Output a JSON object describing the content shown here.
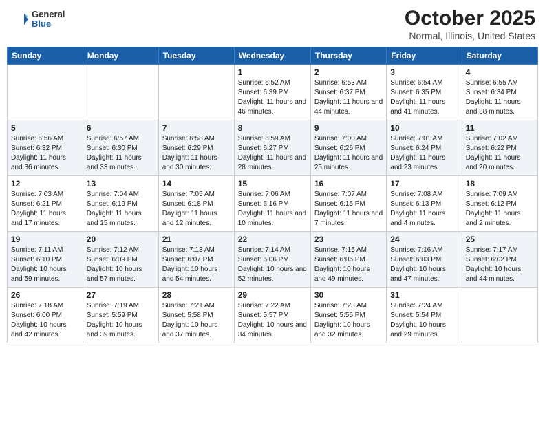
{
  "header": {
    "logo_general": "General",
    "logo_blue": "Blue",
    "title": "October 2025",
    "location": "Normal, Illinois, United States"
  },
  "days_of_week": [
    "Sunday",
    "Monday",
    "Tuesday",
    "Wednesday",
    "Thursday",
    "Friday",
    "Saturday"
  ],
  "weeks": [
    [
      {
        "day": "",
        "info": ""
      },
      {
        "day": "",
        "info": ""
      },
      {
        "day": "",
        "info": ""
      },
      {
        "day": "1",
        "info": "Sunrise: 6:52 AM\nSunset: 6:39 PM\nDaylight: 11 hours and 46 minutes."
      },
      {
        "day": "2",
        "info": "Sunrise: 6:53 AM\nSunset: 6:37 PM\nDaylight: 11 hours and 44 minutes."
      },
      {
        "day": "3",
        "info": "Sunrise: 6:54 AM\nSunset: 6:35 PM\nDaylight: 11 hours and 41 minutes."
      },
      {
        "day": "4",
        "info": "Sunrise: 6:55 AM\nSunset: 6:34 PM\nDaylight: 11 hours and 38 minutes."
      }
    ],
    [
      {
        "day": "5",
        "info": "Sunrise: 6:56 AM\nSunset: 6:32 PM\nDaylight: 11 hours and 36 minutes."
      },
      {
        "day": "6",
        "info": "Sunrise: 6:57 AM\nSunset: 6:30 PM\nDaylight: 11 hours and 33 minutes."
      },
      {
        "day": "7",
        "info": "Sunrise: 6:58 AM\nSunset: 6:29 PM\nDaylight: 11 hours and 30 minutes."
      },
      {
        "day": "8",
        "info": "Sunrise: 6:59 AM\nSunset: 6:27 PM\nDaylight: 11 hours and 28 minutes."
      },
      {
        "day": "9",
        "info": "Sunrise: 7:00 AM\nSunset: 6:26 PM\nDaylight: 11 hours and 25 minutes."
      },
      {
        "day": "10",
        "info": "Sunrise: 7:01 AM\nSunset: 6:24 PM\nDaylight: 11 hours and 23 minutes."
      },
      {
        "day": "11",
        "info": "Sunrise: 7:02 AM\nSunset: 6:22 PM\nDaylight: 11 hours and 20 minutes."
      }
    ],
    [
      {
        "day": "12",
        "info": "Sunrise: 7:03 AM\nSunset: 6:21 PM\nDaylight: 11 hours and 17 minutes."
      },
      {
        "day": "13",
        "info": "Sunrise: 7:04 AM\nSunset: 6:19 PM\nDaylight: 11 hours and 15 minutes."
      },
      {
        "day": "14",
        "info": "Sunrise: 7:05 AM\nSunset: 6:18 PM\nDaylight: 11 hours and 12 minutes."
      },
      {
        "day": "15",
        "info": "Sunrise: 7:06 AM\nSunset: 6:16 PM\nDaylight: 11 hours and 10 minutes."
      },
      {
        "day": "16",
        "info": "Sunrise: 7:07 AM\nSunset: 6:15 PM\nDaylight: 11 hours and 7 minutes."
      },
      {
        "day": "17",
        "info": "Sunrise: 7:08 AM\nSunset: 6:13 PM\nDaylight: 11 hours and 4 minutes."
      },
      {
        "day": "18",
        "info": "Sunrise: 7:09 AM\nSunset: 6:12 PM\nDaylight: 11 hours and 2 minutes."
      }
    ],
    [
      {
        "day": "19",
        "info": "Sunrise: 7:11 AM\nSunset: 6:10 PM\nDaylight: 10 hours and 59 minutes."
      },
      {
        "day": "20",
        "info": "Sunrise: 7:12 AM\nSunset: 6:09 PM\nDaylight: 10 hours and 57 minutes."
      },
      {
        "day": "21",
        "info": "Sunrise: 7:13 AM\nSunset: 6:07 PM\nDaylight: 10 hours and 54 minutes."
      },
      {
        "day": "22",
        "info": "Sunrise: 7:14 AM\nSunset: 6:06 PM\nDaylight: 10 hours and 52 minutes."
      },
      {
        "day": "23",
        "info": "Sunrise: 7:15 AM\nSunset: 6:05 PM\nDaylight: 10 hours and 49 minutes."
      },
      {
        "day": "24",
        "info": "Sunrise: 7:16 AM\nSunset: 6:03 PM\nDaylight: 10 hours and 47 minutes."
      },
      {
        "day": "25",
        "info": "Sunrise: 7:17 AM\nSunset: 6:02 PM\nDaylight: 10 hours and 44 minutes."
      }
    ],
    [
      {
        "day": "26",
        "info": "Sunrise: 7:18 AM\nSunset: 6:00 PM\nDaylight: 10 hours and 42 minutes."
      },
      {
        "day": "27",
        "info": "Sunrise: 7:19 AM\nSunset: 5:59 PM\nDaylight: 10 hours and 39 minutes."
      },
      {
        "day": "28",
        "info": "Sunrise: 7:21 AM\nSunset: 5:58 PM\nDaylight: 10 hours and 37 minutes."
      },
      {
        "day": "29",
        "info": "Sunrise: 7:22 AM\nSunset: 5:57 PM\nDaylight: 10 hours and 34 minutes."
      },
      {
        "day": "30",
        "info": "Sunrise: 7:23 AM\nSunset: 5:55 PM\nDaylight: 10 hours and 32 minutes."
      },
      {
        "day": "31",
        "info": "Sunrise: 7:24 AM\nSunset: 5:54 PM\nDaylight: 10 hours and 29 minutes."
      },
      {
        "day": "",
        "info": ""
      }
    ]
  ]
}
